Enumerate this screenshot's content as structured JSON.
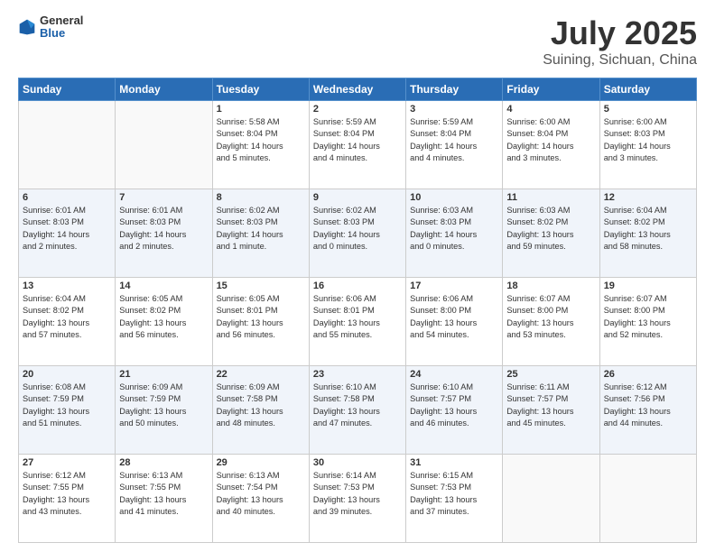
{
  "header": {
    "logo_general": "General",
    "logo_blue": "Blue",
    "title": "July 2025",
    "subtitle": "Suining, Sichuan, China"
  },
  "days_of_week": [
    "Sunday",
    "Monday",
    "Tuesday",
    "Wednesday",
    "Thursday",
    "Friday",
    "Saturday"
  ],
  "weeks": [
    [
      {
        "day": "",
        "info": ""
      },
      {
        "day": "",
        "info": ""
      },
      {
        "day": "1",
        "info": "Sunrise: 5:58 AM\nSunset: 8:04 PM\nDaylight: 14 hours\nand 5 minutes."
      },
      {
        "day": "2",
        "info": "Sunrise: 5:59 AM\nSunset: 8:04 PM\nDaylight: 14 hours\nand 4 minutes."
      },
      {
        "day": "3",
        "info": "Sunrise: 5:59 AM\nSunset: 8:04 PM\nDaylight: 14 hours\nand 4 minutes."
      },
      {
        "day": "4",
        "info": "Sunrise: 6:00 AM\nSunset: 8:04 PM\nDaylight: 14 hours\nand 3 minutes."
      },
      {
        "day": "5",
        "info": "Sunrise: 6:00 AM\nSunset: 8:03 PM\nDaylight: 14 hours\nand 3 minutes."
      }
    ],
    [
      {
        "day": "6",
        "info": "Sunrise: 6:01 AM\nSunset: 8:03 PM\nDaylight: 14 hours\nand 2 minutes."
      },
      {
        "day": "7",
        "info": "Sunrise: 6:01 AM\nSunset: 8:03 PM\nDaylight: 14 hours\nand 2 minutes."
      },
      {
        "day": "8",
        "info": "Sunrise: 6:02 AM\nSunset: 8:03 PM\nDaylight: 14 hours\nand 1 minute."
      },
      {
        "day": "9",
        "info": "Sunrise: 6:02 AM\nSunset: 8:03 PM\nDaylight: 14 hours\nand 0 minutes."
      },
      {
        "day": "10",
        "info": "Sunrise: 6:03 AM\nSunset: 8:03 PM\nDaylight: 14 hours\nand 0 minutes."
      },
      {
        "day": "11",
        "info": "Sunrise: 6:03 AM\nSunset: 8:02 PM\nDaylight: 13 hours\nand 59 minutes."
      },
      {
        "day": "12",
        "info": "Sunrise: 6:04 AM\nSunset: 8:02 PM\nDaylight: 13 hours\nand 58 minutes."
      }
    ],
    [
      {
        "day": "13",
        "info": "Sunrise: 6:04 AM\nSunset: 8:02 PM\nDaylight: 13 hours\nand 57 minutes."
      },
      {
        "day": "14",
        "info": "Sunrise: 6:05 AM\nSunset: 8:02 PM\nDaylight: 13 hours\nand 56 minutes."
      },
      {
        "day": "15",
        "info": "Sunrise: 6:05 AM\nSunset: 8:01 PM\nDaylight: 13 hours\nand 56 minutes."
      },
      {
        "day": "16",
        "info": "Sunrise: 6:06 AM\nSunset: 8:01 PM\nDaylight: 13 hours\nand 55 minutes."
      },
      {
        "day": "17",
        "info": "Sunrise: 6:06 AM\nSunset: 8:00 PM\nDaylight: 13 hours\nand 54 minutes."
      },
      {
        "day": "18",
        "info": "Sunrise: 6:07 AM\nSunset: 8:00 PM\nDaylight: 13 hours\nand 53 minutes."
      },
      {
        "day": "19",
        "info": "Sunrise: 6:07 AM\nSunset: 8:00 PM\nDaylight: 13 hours\nand 52 minutes."
      }
    ],
    [
      {
        "day": "20",
        "info": "Sunrise: 6:08 AM\nSunset: 7:59 PM\nDaylight: 13 hours\nand 51 minutes."
      },
      {
        "day": "21",
        "info": "Sunrise: 6:09 AM\nSunset: 7:59 PM\nDaylight: 13 hours\nand 50 minutes."
      },
      {
        "day": "22",
        "info": "Sunrise: 6:09 AM\nSunset: 7:58 PM\nDaylight: 13 hours\nand 48 minutes."
      },
      {
        "day": "23",
        "info": "Sunrise: 6:10 AM\nSunset: 7:58 PM\nDaylight: 13 hours\nand 47 minutes."
      },
      {
        "day": "24",
        "info": "Sunrise: 6:10 AM\nSunset: 7:57 PM\nDaylight: 13 hours\nand 46 minutes."
      },
      {
        "day": "25",
        "info": "Sunrise: 6:11 AM\nSunset: 7:57 PM\nDaylight: 13 hours\nand 45 minutes."
      },
      {
        "day": "26",
        "info": "Sunrise: 6:12 AM\nSunset: 7:56 PM\nDaylight: 13 hours\nand 44 minutes."
      }
    ],
    [
      {
        "day": "27",
        "info": "Sunrise: 6:12 AM\nSunset: 7:55 PM\nDaylight: 13 hours\nand 43 minutes."
      },
      {
        "day": "28",
        "info": "Sunrise: 6:13 AM\nSunset: 7:55 PM\nDaylight: 13 hours\nand 41 minutes."
      },
      {
        "day": "29",
        "info": "Sunrise: 6:13 AM\nSunset: 7:54 PM\nDaylight: 13 hours\nand 40 minutes."
      },
      {
        "day": "30",
        "info": "Sunrise: 6:14 AM\nSunset: 7:53 PM\nDaylight: 13 hours\nand 39 minutes."
      },
      {
        "day": "31",
        "info": "Sunrise: 6:15 AM\nSunset: 7:53 PM\nDaylight: 13 hours\nand 37 minutes."
      },
      {
        "day": "",
        "info": ""
      },
      {
        "day": "",
        "info": ""
      }
    ]
  ]
}
